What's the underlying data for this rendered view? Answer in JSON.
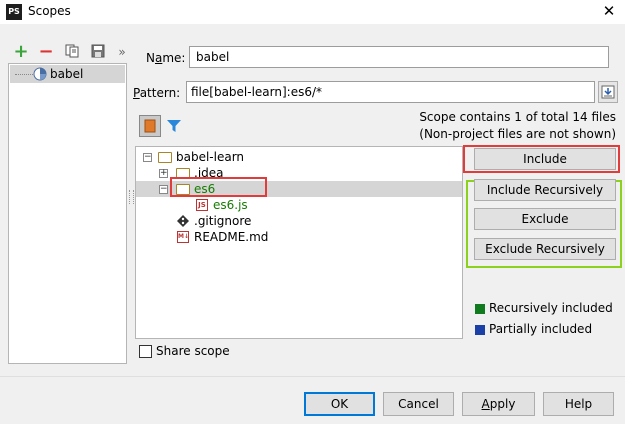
{
  "window": {
    "app_icon_text": "PS",
    "title": "Scopes",
    "close_glyph": "✕"
  },
  "toolbar": {
    "add_glyph": "+",
    "remove_glyph": "−",
    "more_glyph": "»"
  },
  "scopes": [
    {
      "label": "babel",
      "selected": true
    }
  ],
  "form": {
    "name_label_pre": "N",
    "name_label_ul": "a",
    "name_label_post": "me:",
    "name_value": "babel",
    "pattern_label_ul": "P",
    "pattern_label_post": "attern:",
    "pattern_value": "file[babel-learn]:es6/*"
  },
  "info": {
    "line1": "Scope contains 1 of total 14 files",
    "line2": "(Non-project files are not shown)"
  },
  "tree": {
    "root": "babel-learn",
    "idea": ".idea",
    "es6": "es6",
    "es6js": "es6.js",
    "js_badge": "JS",
    "gitignore": ".gitignore",
    "readme": "README.md",
    "md_badge": "M↓"
  },
  "buttons": {
    "include": "Include",
    "include_recursively": "Include Recursively",
    "exclude": "Exclude",
    "exclude_recursively": "Exclude Recursively"
  },
  "legend": {
    "recursively_included": "Recursively included",
    "partially_included": "Partially included",
    "recursive_color": "#0f7a1e",
    "partial_color": "#1a3fa6"
  },
  "share_scope": {
    "label": "Share scope",
    "checked": false
  },
  "dialog": {
    "ok": "OK",
    "cancel": "Cancel",
    "apply_ul": "A",
    "apply_post": "pply",
    "help": "Help"
  }
}
